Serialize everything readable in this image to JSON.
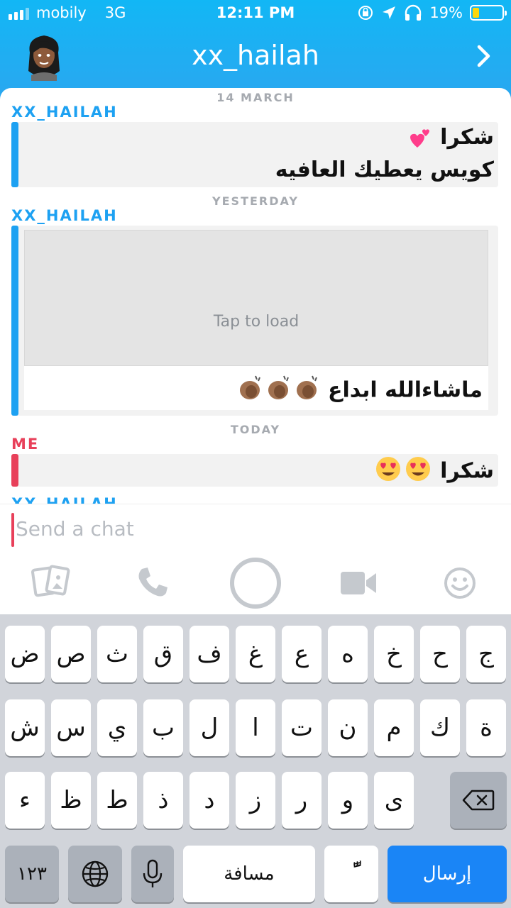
{
  "status_bar": {
    "carrier": "mobily",
    "network": "3G",
    "time": "12:11 PM",
    "battery": "19%",
    "battery_level": 0.19
  },
  "header": {
    "title": "xx_hailah",
    "avatar_icon": "bitmoji-avatar",
    "forward_icon": "chevron-right-icon"
  },
  "chat": {
    "sections": [
      {
        "date": "14 MARCH",
        "sender": "XX_HAILAH",
        "lines": [
          "شكرا",
          "كويس يعطيك العافيه"
        ]
      },
      {
        "date": "YESTERDAY",
        "sender": "XX_HAILAH",
        "media_label": "Tap to load",
        "caption": "ماشاءالله ابداع"
      },
      {
        "date": "TODAY",
        "sender": "ME",
        "lines": [
          "شكرا"
        ]
      }
    ],
    "next_sender_partial": "XX_HAILAH"
  },
  "input": {
    "placeholder": "Send a chat"
  },
  "toolbar": {
    "icons": [
      "memories-icon",
      "phone-icon",
      "capture-button",
      "video-icon",
      "emoji-icon"
    ]
  },
  "keyboard": {
    "row1": [
      "ج",
      "ح",
      "خ",
      "ه",
      "ع",
      "غ",
      "ف",
      "ق",
      "ث",
      "ص",
      "ض"
    ],
    "row2": [
      "ة",
      "ك",
      "م",
      "ن",
      "ت",
      "ا",
      "ل",
      "ب",
      "ي",
      "س",
      "ش"
    ],
    "row3": [
      "ى",
      "و",
      "ر",
      "ز",
      "د",
      "ذ",
      "ط",
      "ظ",
      "ء"
    ],
    "numbers_key": "١٢٣",
    "space_key": "مسافة",
    "send_key": "إرسال",
    "diacritic_key": "ًّ"
  },
  "colors": {
    "header_blue": "#1da1f2",
    "me_red": "#e8405a",
    "send_blue": "#1a85f6"
  }
}
